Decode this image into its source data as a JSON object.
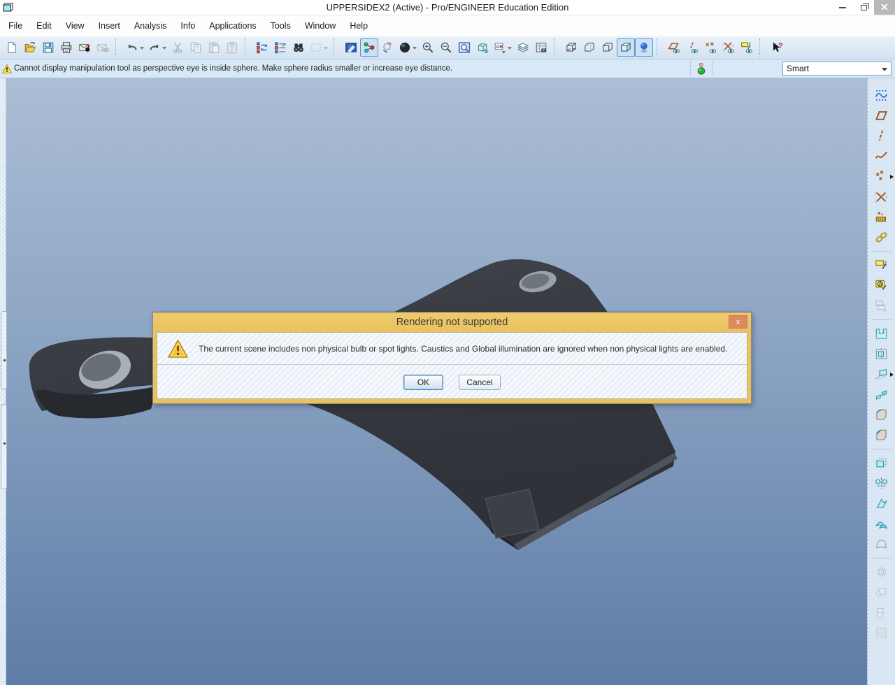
{
  "window": {
    "title": "UPPERSIDEX2 (Active) - Pro/ENGINEER Education Edition",
    "app_icon": "part-cube-icon",
    "controls": [
      "minimize",
      "restore",
      "close"
    ]
  },
  "menu": {
    "items": [
      "File",
      "Edit",
      "View",
      "Insert",
      "Analysis",
      "Info",
      "Applications",
      "Tools",
      "Window",
      "Help"
    ]
  },
  "toolbar": {
    "groups": [
      {
        "buttons": [
          {
            "icon": "new-file"
          },
          {
            "icon": "open-file"
          },
          {
            "icon": "save-file"
          },
          {
            "icon": "print"
          },
          {
            "icon": "send-mail"
          },
          {
            "icon": "mail-link",
            "disabled": true
          }
        ]
      },
      {
        "buttons": [
          {
            "icon": "undo",
            "dropdown": true
          },
          {
            "icon": "redo",
            "dropdown": true
          },
          {
            "icon": "cut",
            "disabled": true
          },
          {
            "icon": "copy",
            "disabled": true
          },
          {
            "icon": "paste",
            "disabled": true
          },
          {
            "icon": "paste-special",
            "disabled": true
          }
        ]
      },
      {
        "buttons": [
          {
            "icon": "regenerate"
          },
          {
            "icon": "custom-regenerate"
          },
          {
            "icon": "find"
          },
          {
            "icon": "select-box",
            "disabled": true,
            "dropdown": true
          }
        ]
      },
      {
        "buttons": [
          {
            "icon": "redraw"
          },
          {
            "icon": "spin-center",
            "pressed": true
          },
          {
            "icon": "orient-mode"
          },
          {
            "icon": "shaded-sphere",
            "dropdown": true
          },
          {
            "icon": "zoom-in"
          },
          {
            "icon": "zoom-out"
          },
          {
            "icon": "zoom-fit"
          },
          {
            "icon": "reorient"
          },
          {
            "icon": "saved-views",
            "dropdown": true
          },
          {
            "icon": "layers"
          },
          {
            "icon": "view-manager"
          }
        ]
      },
      {
        "buttons": [
          {
            "icon": "cube-wireframe"
          },
          {
            "icon": "cube-hidden-line"
          },
          {
            "icon": "cube-no-hidden"
          },
          {
            "icon": "cube-shaded",
            "pressed": true
          },
          {
            "icon": "enhanced-realism",
            "pressed": true
          }
        ]
      },
      {
        "buttons": [
          {
            "icon": "datum-plane-display"
          },
          {
            "icon": "datum-axis-display"
          },
          {
            "icon": "datum-point-display"
          },
          {
            "icon": "csys-display"
          },
          {
            "icon": "annotation-display"
          }
        ]
      },
      {
        "buttons": [
          {
            "icon": "context-help"
          }
        ]
      }
    ]
  },
  "message_bar": {
    "icon": "warning-triangle-icon",
    "text": "Cannot display manipulation tool as perspective eye is inside sphere. Make sphere radius smaller or increase eye distance.",
    "status_icon": "light-status-icon",
    "filter_label": "Smart"
  },
  "dialog": {
    "icon": "warning-triangle-icon",
    "title": "Rendering not supported",
    "message": "The current scene includes non physical bulb or spot lights. Caustics and Global illumination are ignored when non physical lights are enabled.",
    "ok_label": "OK",
    "cancel_label": "Cancel"
  },
  "right_toolbar": {
    "groups": [
      {
        "buttons": [
          {
            "icon": "style-tool"
          },
          {
            "icon": "datum-plane-tool"
          },
          {
            "icon": "datum-axis-tool"
          },
          {
            "icon": "datum-curve-tool"
          },
          {
            "icon": "datum-point-tool",
            "flyout": true
          },
          {
            "icon": "csys-tool"
          },
          {
            "icon": "sketch-tool"
          },
          {
            "icon": "copy-geometry-tool"
          }
        ]
      },
      {
        "buttons": [
          {
            "icon": "annotation-tool"
          },
          {
            "icon": "annotation-feature-tool"
          },
          {
            "icon": "annotation-stack-tool",
            "disabled": true
          }
        ]
      },
      {
        "buttons": [
          {
            "icon": "extrude-tool"
          },
          {
            "icon": "revolve-tool"
          },
          {
            "icon": "sweep-tool",
            "flyout": true
          },
          {
            "icon": "blend-tool"
          },
          {
            "icon": "round-tool"
          },
          {
            "icon": "chamfer-tool"
          }
        ]
      },
      {
        "buttons": [
          {
            "icon": "extrude-surface-tool"
          },
          {
            "icon": "mirror-tool"
          },
          {
            "icon": "trim-tool"
          },
          {
            "icon": "merge-tool"
          },
          {
            "icon": "pattern-surface-tool"
          }
        ]
      },
      {
        "buttons": [
          {
            "icon": "mirror-tool-2",
            "disabled": true
          },
          {
            "icon": "trim-tool-2",
            "disabled": true
          },
          {
            "icon": "extend-tool",
            "disabled": true
          },
          {
            "icon": "pattern-tool",
            "disabled": true
          }
        ]
      }
    ]
  },
  "viewport": {
    "gradient_top": "#abbed5",
    "gradient_mid": "#8ba3c3",
    "gradient_bottom": "#5e7ca6",
    "part_color": "#35383e"
  },
  "colors": {
    "dialog_titlebar": "#e9c25c",
    "dialog_titlebar_light": "#edca6e",
    "dialog_close": "#dd8a60",
    "accent_blue": "#5a96c8"
  }
}
